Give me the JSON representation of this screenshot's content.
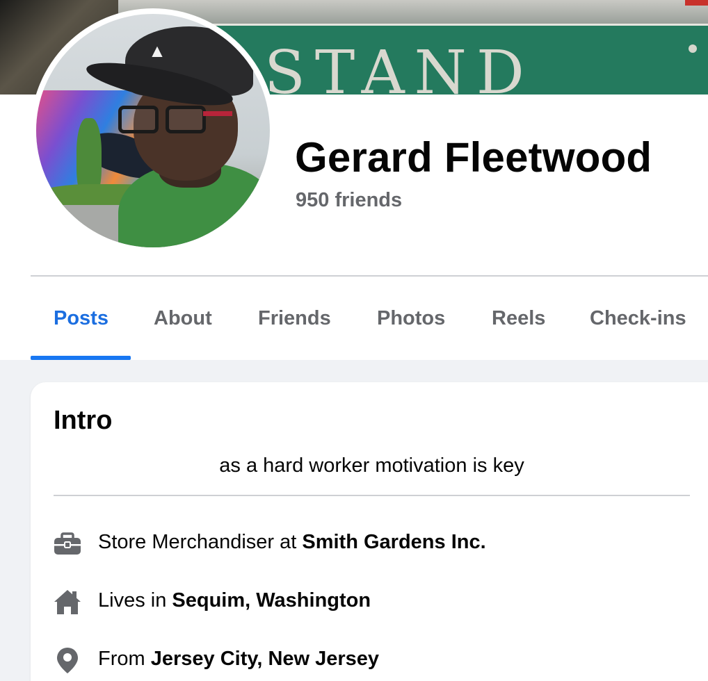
{
  "cover": {
    "sign_text": "STAND"
  },
  "profile": {
    "name": "Gerard Fleetwood",
    "friends": "950 friends"
  },
  "tabs": [
    {
      "label": "Posts",
      "active": true
    },
    {
      "label": "About",
      "active": false
    },
    {
      "label": "Friends",
      "active": false
    },
    {
      "label": "Photos",
      "active": false
    },
    {
      "label": "Reels",
      "active": false
    },
    {
      "label": "Check-ins",
      "active": false
    }
  ],
  "intro": {
    "title": "Intro",
    "bio": "as a hard worker motivation is key",
    "work": {
      "prefix": "Store Merchandiser at ",
      "value": "Smith Gardens Inc.",
      "icon": "briefcase-icon"
    },
    "lives": {
      "prefix": "Lives in ",
      "value": "Sequim, Washington",
      "icon": "home-icon"
    },
    "from": {
      "prefix": "From ",
      "value": "Jersey City, New Jersey",
      "icon": "location-pin-icon"
    }
  },
  "colors": {
    "accent": "#1877f2",
    "active_tab_text": "#1b6ee0",
    "secondary_text": "#65676b",
    "primary_text": "#050505",
    "page_bg": "#f0f2f5",
    "icon_gray": "#65676b"
  }
}
